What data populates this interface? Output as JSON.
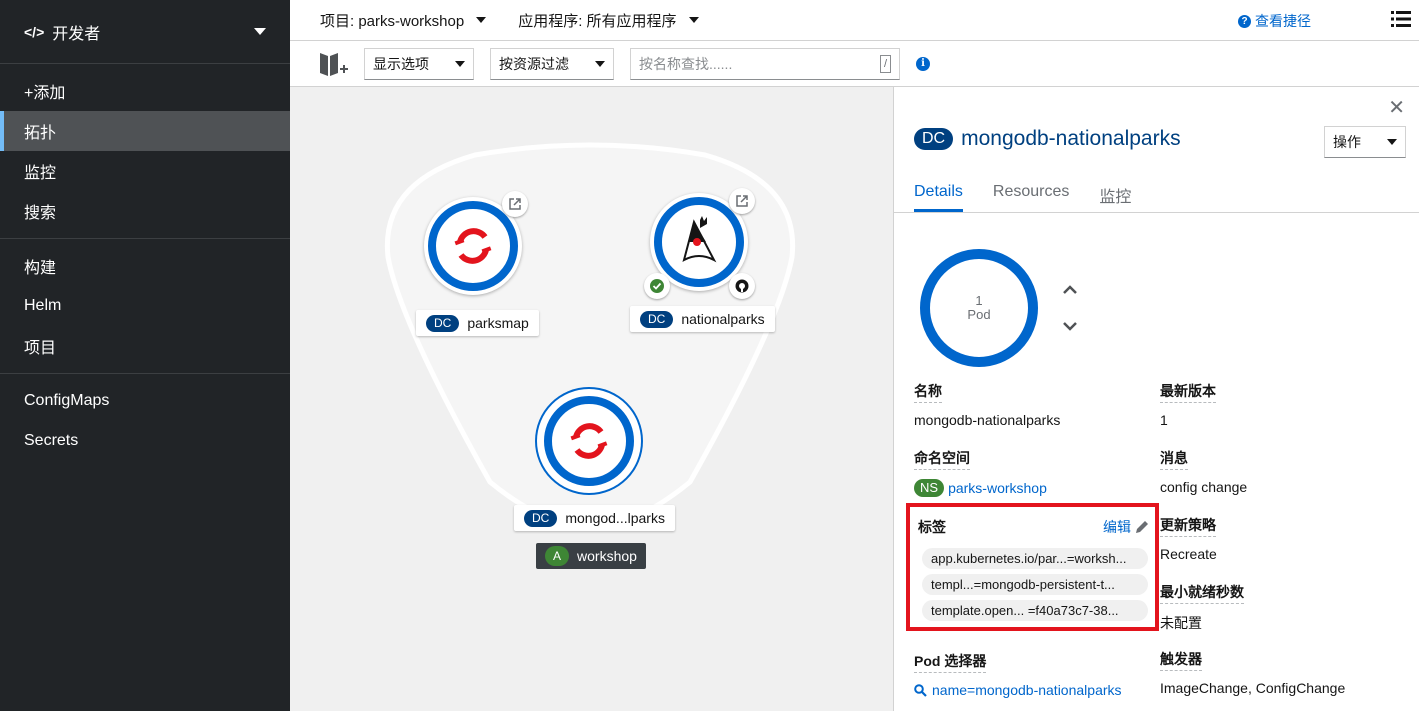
{
  "sidebar": {
    "perspective": "开发者",
    "groups": [
      [
        {
          "label": "+添加"
        },
        {
          "label": "拓扑"
        },
        {
          "label": "监控"
        },
        {
          "label": "搜索"
        }
      ],
      [
        {
          "label": "构建"
        },
        {
          "label": "Helm"
        },
        {
          "label": "项目"
        }
      ],
      [
        {
          "label": "ConfigMaps"
        },
        {
          "label": "Secrets"
        }
      ]
    ]
  },
  "topbar": {
    "project": "项目: parks-workshop",
    "application": "应用程序: 所有应用程序",
    "shortcuts": "查看捷径"
  },
  "toolbar": {
    "display_options": "显示选项",
    "filter_by_resource": "按资源过滤",
    "search_placeholder": "按名称查找......",
    "slash": "/"
  },
  "topology": {
    "nodes": [
      {
        "kind": "DC",
        "name": "parksmap"
      },
      {
        "kind": "DC",
        "name": "nationalparks"
      },
      {
        "kind": "DC",
        "name": "mongod...lparks"
      }
    ],
    "app_group": {
      "badge": "A",
      "name": "workshop"
    }
  },
  "panel": {
    "kind": "DC",
    "title": "mongodb-nationalparks",
    "actions": "操作",
    "tabs": [
      "Details",
      "Resources",
      "监控"
    ],
    "pod": {
      "count": "1",
      "unit": "Pod"
    },
    "fields": {
      "name": {
        "label": "名称",
        "value": "mongodb-nationalparks"
      },
      "latest_version": {
        "label": "最新版本",
        "value": "1"
      },
      "namespace": {
        "label": "命名空间",
        "badge": "NS",
        "value": "parks-workshop"
      },
      "message": {
        "label": "消息",
        "value": "config change"
      },
      "update_strategy": {
        "label": "更新策略",
        "value": "Recreate"
      },
      "min_ready": {
        "label": "最小就绪秒数",
        "value": "未配置"
      },
      "pod_selector": {
        "label": "Pod 选择器",
        "value": "name=mongodb-nationalparks"
      },
      "triggers": {
        "label": "触发器",
        "value": "ImageChange, ConfigChange"
      }
    },
    "labels": {
      "title": "标签",
      "edit": "编辑",
      "chips": [
        "app.kubernetes.io/par...=worksh...",
        "templ...=mongodb-persistent-t...",
        "template.open... =f40a73c7-38..."
      ]
    }
  },
  "colors": {
    "accent": "#0066cc",
    "dc_badge": "#004080",
    "highlight": "#e3141d",
    "ns_badge": "#3e8635"
  }
}
